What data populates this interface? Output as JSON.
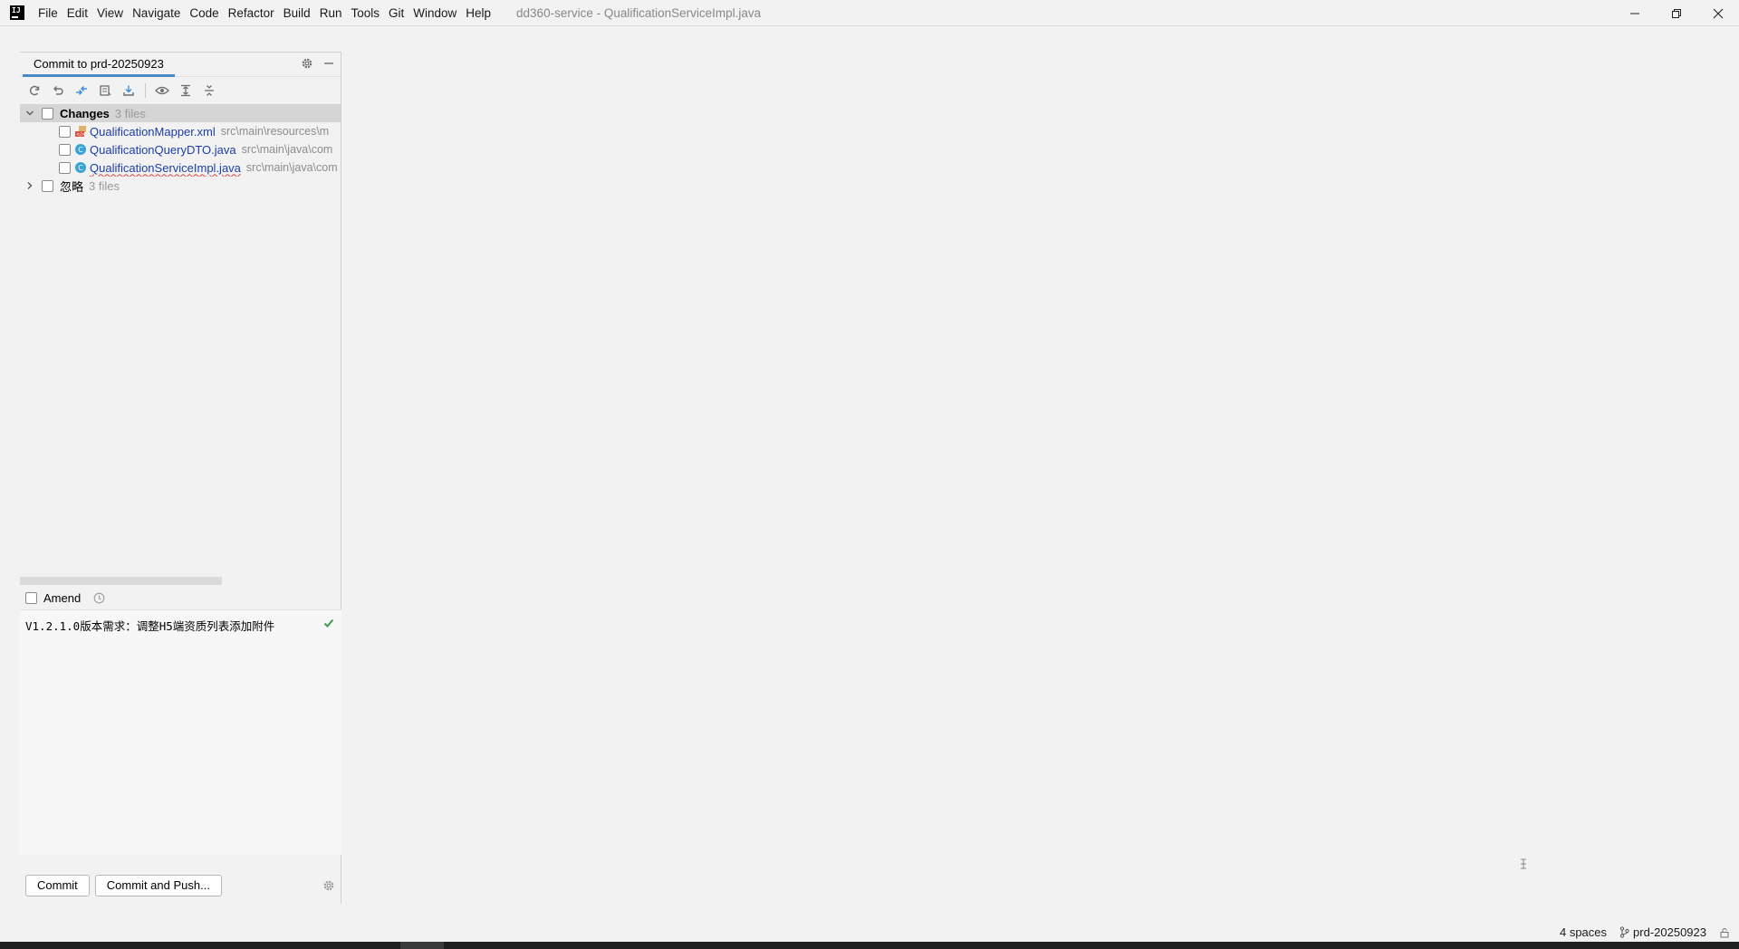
{
  "menu": [
    "File",
    "Edit",
    "View",
    "Navigate",
    "Code",
    "Refactor",
    "Build",
    "Run",
    "Tools",
    "Git",
    "Window",
    "Help"
  ],
  "window": {
    "title": "dd360-service - QualificationServiceImpl.java"
  },
  "commit_panel": {
    "tab_label": "Commit to prd-20250923",
    "groups": [
      {
        "label": "Changes",
        "count": "3 files",
        "expanded": true
      },
      {
        "label": "忽略",
        "count": "3 files",
        "expanded": false
      }
    ],
    "files": [
      {
        "name": "QualificationMapper.xml",
        "path": "src\\main\\resources\\m",
        "icon": "xml-file-icon"
      },
      {
        "name": "QualificationQueryDTO.java",
        "path": "src\\main\\java\\com",
        "icon": "java-class-icon"
      },
      {
        "name": "QualificationServiceImpl.java",
        "path": "src\\main\\java\\com",
        "icon": "java-class-icon"
      }
    ],
    "amend_label": "Amend",
    "commit_message": "V1.2.1.0版本需求：调整H5端资质列表添加附件",
    "commit_button": "Commit",
    "commit_push_button": "Commit and Push..."
  },
  "statusbar": {
    "indent": "4 spaces",
    "branch": "prd-20250923"
  },
  "colors": {
    "accent": "#4a88c7",
    "file_link": "#1b3da8",
    "check_green": "#389e4a"
  }
}
